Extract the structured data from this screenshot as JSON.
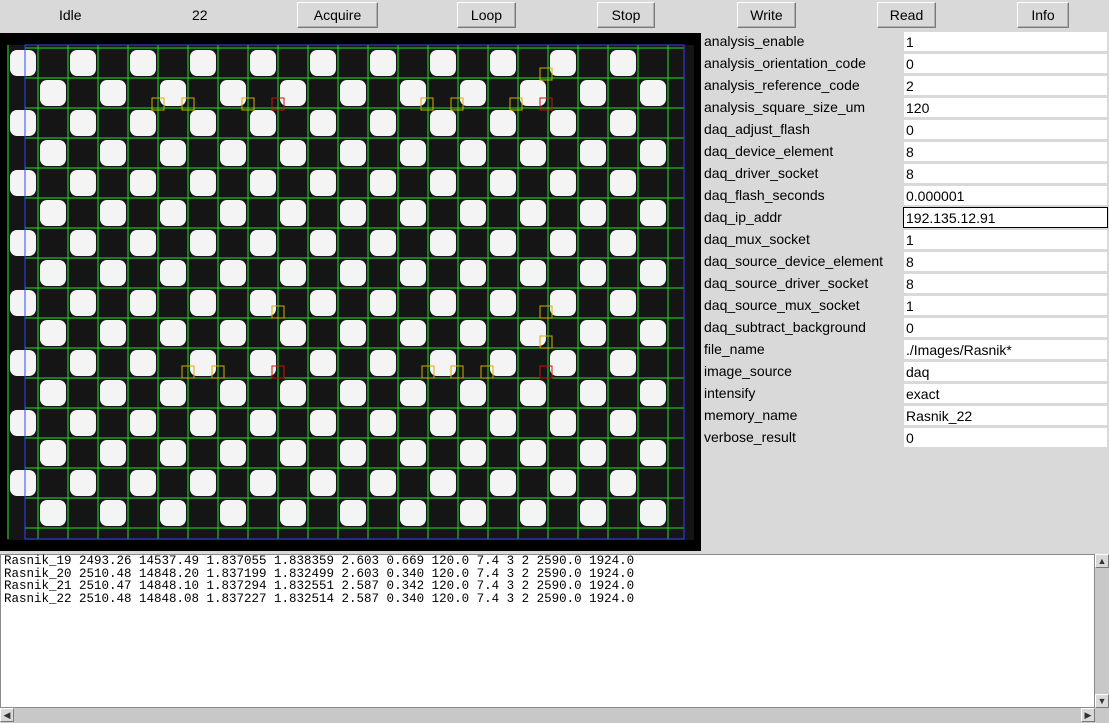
{
  "toolbar": {
    "status": "Idle",
    "counter": "22",
    "buttons": {
      "acquire": "Acquire",
      "loop": "Loop",
      "stop": "Stop",
      "write": "Write",
      "read": "Read",
      "info": "Info"
    }
  },
  "config": [
    {
      "label": "analysis_enable",
      "value": "1"
    },
    {
      "label": "analysis_orientation_code",
      "value": "0"
    },
    {
      "label": "analysis_reference_code",
      "value": "2"
    },
    {
      "label": "analysis_square_size_um",
      "value": "120"
    },
    {
      "label": "daq_adjust_flash",
      "value": "0"
    },
    {
      "label": "daq_device_element",
      "value": "8"
    },
    {
      "label": "daq_driver_socket",
      "value": "8"
    },
    {
      "label": "daq_flash_seconds",
      "value": "0.000001"
    },
    {
      "label": "daq_ip_addr",
      "value": "192.135.12.91"
    },
    {
      "label": "daq_mux_socket",
      "value": "1"
    },
    {
      "label": "daq_source_device_element",
      "value": "8"
    },
    {
      "label": "daq_source_driver_socket",
      "value": "8"
    },
    {
      "label": "daq_source_mux_socket",
      "value": "1"
    },
    {
      "label": "daq_subtract_background",
      "value": "0"
    },
    {
      "label": "file_name",
      "value": "./Images/Rasnik*"
    },
    {
      "label": "image_source",
      "value": "daq"
    },
    {
      "label": "intensify",
      "value": "exact"
    },
    {
      "label": "memory_name",
      "value": "Rasnik_22"
    },
    {
      "label": "verbose_result",
      "value": "0"
    }
  ],
  "results": [
    "Rasnik_19 2493.26 14537.49 1.837055 1.838359 2.603 0.669 120.0 7.4 3 2 2590.0 1924.0",
    "Rasnik_20 2510.48 14848.20 1.837199 1.832499 2.603 0.340 120.0 7.4 3 2 2590.0 1924.0",
    "Rasnik_21 2510.47 14848.10 1.837294 1.832551 2.587 0.342 120.0 7.4 3 2 2590.0 1924.0",
    "Rasnik_22 2510.48 14848.08 1.837227 1.832514 2.587 0.340 120.0 7.4 3 2 2590.0 1924.0"
  ],
  "colors": {
    "grid": "#22dd22",
    "code_marker": "#d4b000",
    "reference_marker": "#cc1111"
  },
  "icons": {
    "scroll_up": "arrow-up-icon",
    "scroll_down": "arrow-down-icon",
    "scroll_left": "arrow-left-icon",
    "scroll_right": "arrow-right-icon"
  }
}
